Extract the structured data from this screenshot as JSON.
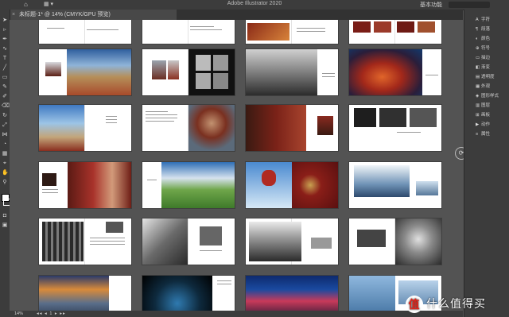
{
  "app": {
    "title": "Adobe Illustrator 2020"
  },
  "menubar": {
    "workspace": "基本功能"
  },
  "document_tab": {
    "label": "未标题-1* @ 14% (CMYK/GPU 预览)"
  },
  "panels": [
    {
      "icon": "A",
      "label": "字符"
    },
    {
      "icon": "¶",
      "label": "段落"
    },
    {
      "icon": "◐",
      "label": "颜色"
    },
    {
      "icon": "⊕",
      "label": "符号"
    },
    {
      "icon": "▭",
      "label": "描边"
    },
    {
      "icon": "◧",
      "label": "渐变"
    },
    {
      "icon": "▤",
      "label": "透明度"
    },
    {
      "icon": "▦",
      "label": "外观"
    },
    {
      "icon": "◈",
      "label": "图形样式"
    },
    {
      "icon": "▥",
      "label": "图层"
    },
    {
      "icon": "⊞",
      "label": "画板"
    },
    {
      "icon": "▶",
      "label": "动作"
    },
    {
      "icon": "≡",
      "label": "属性"
    }
  ],
  "status": {
    "zoom": "14%",
    "artboard": "1"
  },
  "watermark": {
    "logo_text": "值",
    "text": "什么值得买"
  },
  "colors": {
    "bg": "#535353",
    "accent": "#e2231a"
  }
}
